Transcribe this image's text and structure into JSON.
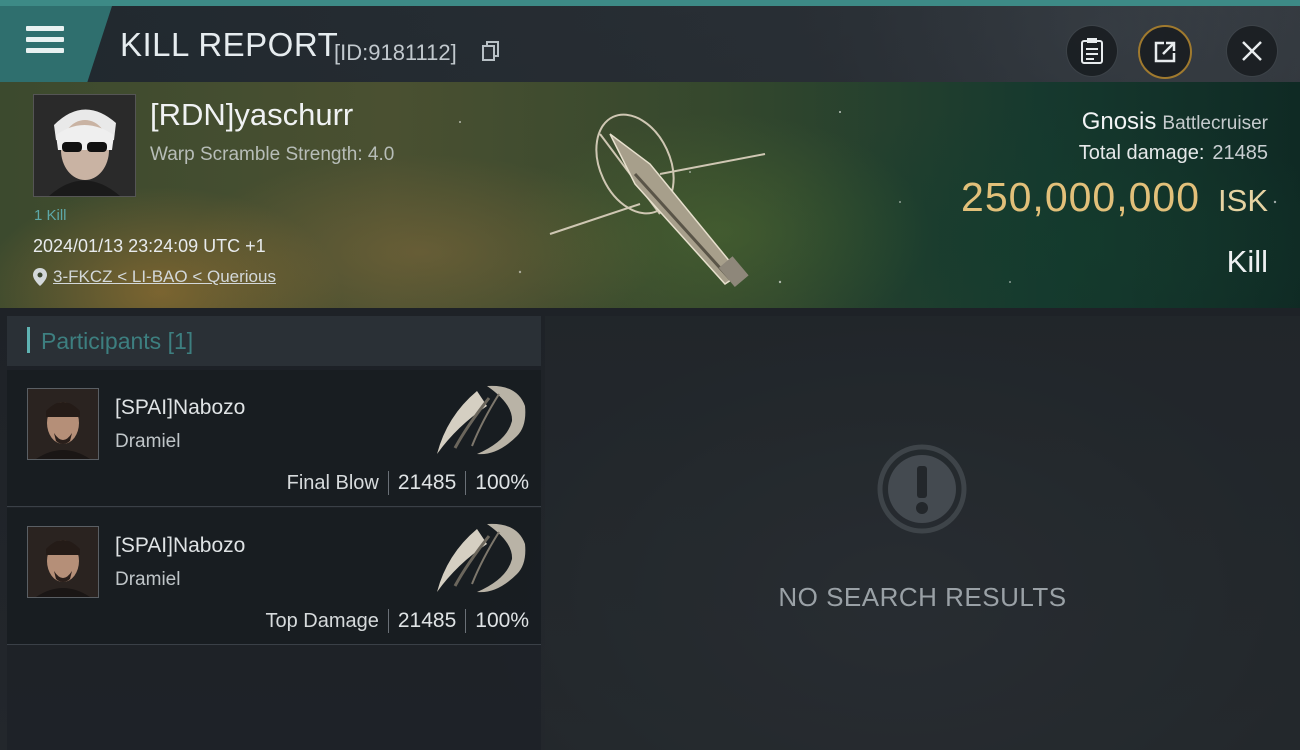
{
  "header": {
    "title": "KILL REPORT",
    "report_id": "[ID:9181112]"
  },
  "victim": {
    "name": "[RDN]yaschurr",
    "warp_scramble": "Warp Scramble Strength: 4.0",
    "kills_label": "1 Kill",
    "datetime": "2024/01/13 23:24:09 UTC +1",
    "location": "3-FKCZ < LI-BAO < Querious",
    "ship_name": "Gnosis",
    "ship_class": "Battlecruiser",
    "total_damage_label": "Total damage:",
    "total_damage_value": "21485",
    "isk_amount": "250,000,000",
    "isk_unit": "ISK",
    "result": "Kill"
  },
  "participants": {
    "title": "Participants",
    "count": "[1]",
    "rows": [
      {
        "name": "[SPAI]Nabozo",
        "ship": "Dramiel",
        "tag": "Final Blow",
        "damage": "21485",
        "percent": "100%"
      },
      {
        "name": "[SPAI]Nabozo",
        "ship": "Dramiel",
        "tag": "Top Damage",
        "damage": "21485",
        "percent": "100%"
      }
    ]
  },
  "empty_state": {
    "message": "NO SEARCH RESULTS"
  },
  "colors": {
    "accent_teal": "#3d8a86",
    "isk_gold": "#e2c07a",
    "share_ring": "#a07a2e"
  },
  "icons": [
    "menu-icon",
    "copy-icon",
    "clipboard-icon",
    "share-icon",
    "close-icon",
    "location-pin-icon",
    "alert-icon"
  ]
}
